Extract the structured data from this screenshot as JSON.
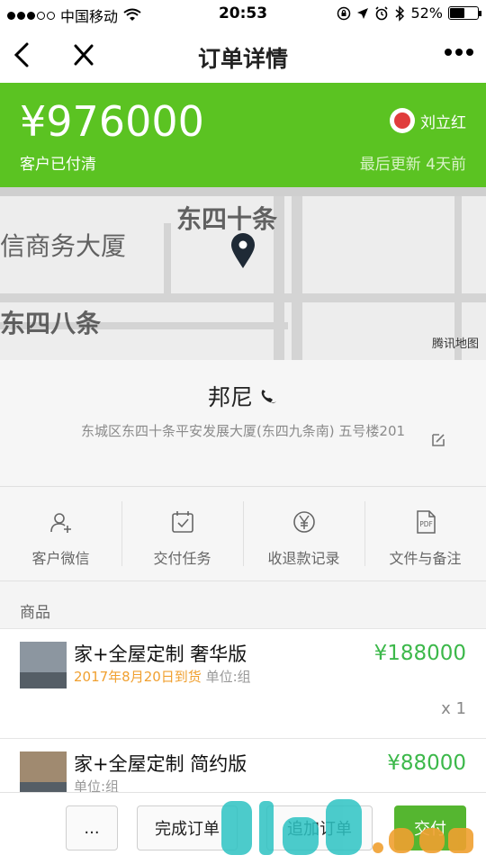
{
  "status_bar": {
    "carrier": "中国移动",
    "time": "20:53",
    "battery_text": "52%",
    "battery_level": 0.52
  },
  "nav": {
    "title": "订单详情"
  },
  "summary": {
    "amount": "¥976000",
    "payment_status": "客户已付清",
    "user_name": "刘立红",
    "last_update": "最后更新 4天前"
  },
  "map": {
    "labels": [
      "东四十条",
      "信商务大厦",
      "东四八条"
    ],
    "credit": "腾讯地图"
  },
  "contact": {
    "name": "邦尼",
    "address": "东城区东四十条平安发展大厦(东四九条南) 五号楼201"
  },
  "actions": [
    {
      "label": "客户微信",
      "icon": "add-user-icon"
    },
    {
      "label": "交付任务",
      "icon": "calendar-check-icon"
    },
    {
      "label": "收退款记录",
      "icon": "yuan-icon"
    },
    {
      "label": "文件与备注",
      "icon": "pdf-file-icon"
    }
  ],
  "products_section": {
    "title": "商品"
  },
  "products": [
    {
      "name": "家+全屋定制 奢华版",
      "delivery_date": "2017年8月20日到货",
      "unit": "单位:组",
      "price": "¥188000",
      "quantity": "x 1"
    },
    {
      "name": "家+全屋定制 简约版",
      "unit": "单位:组",
      "price": "¥88000"
    }
  ],
  "bottom_bar": {
    "more": "...",
    "complete": "完成订单",
    "append": "追加订单",
    "deliver": "交付"
  },
  "colors": {
    "green": "#5bc322",
    "price_green": "#3cb84a",
    "date_orange": "#f0a030"
  }
}
